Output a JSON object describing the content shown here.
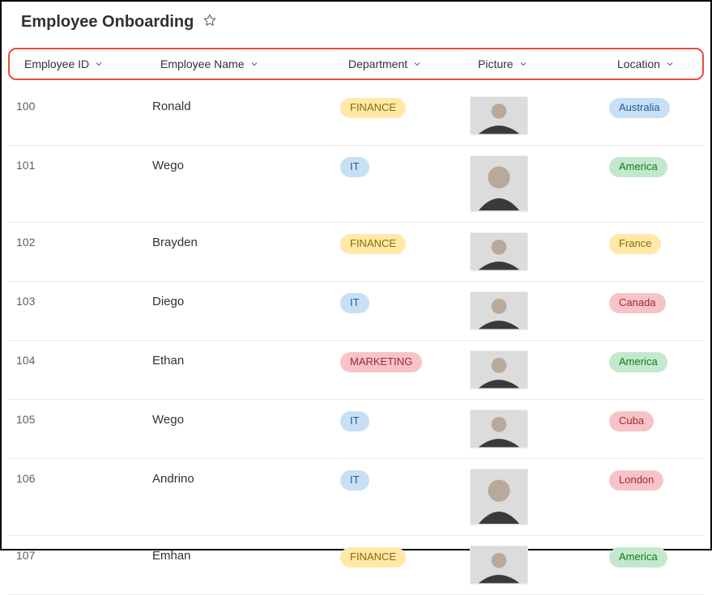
{
  "page": {
    "title": "Employee Onboarding"
  },
  "columns": {
    "id": "Employee ID",
    "name": "Employee Name",
    "department": "Department",
    "picture": "Picture",
    "location": "Location"
  },
  "departmentStyles": {
    "FINANCE": "badge-finance",
    "IT": "badge-it",
    "MARKETING": "badge-marketing"
  },
  "locationStyles": {
    "Australia": "loc-australia",
    "America": "loc-america",
    "France": "loc-france",
    "Canada": "loc-canada",
    "Cuba": "loc-cuba",
    "London": "loc-london"
  },
  "rows": [
    {
      "id": "100",
      "name": "Ronald",
      "department": "FINANCE",
      "location": "Australia",
      "picH": 48
    },
    {
      "id": "101",
      "name": "Wego",
      "department": "IT",
      "location": "America",
      "picH": 70
    },
    {
      "id": "102",
      "name": "Brayden",
      "department": "FINANCE",
      "location": "France",
      "picH": 48
    },
    {
      "id": "103",
      "name": "Diego",
      "department": "IT",
      "location": "Canada",
      "picH": 48
    },
    {
      "id": "104",
      "name": "Ethan",
      "department": "MARKETING",
      "location": "America",
      "picH": 48
    },
    {
      "id": "105",
      "name": "Wego",
      "department": "IT",
      "location": "Cuba",
      "picH": 48
    },
    {
      "id": "106",
      "name": "Andrino",
      "department": "IT",
      "location": "London",
      "picH": 70
    },
    {
      "id": "107",
      "name": "Emhan",
      "department": "FINANCE",
      "location": "America",
      "picH": 48
    }
  ]
}
